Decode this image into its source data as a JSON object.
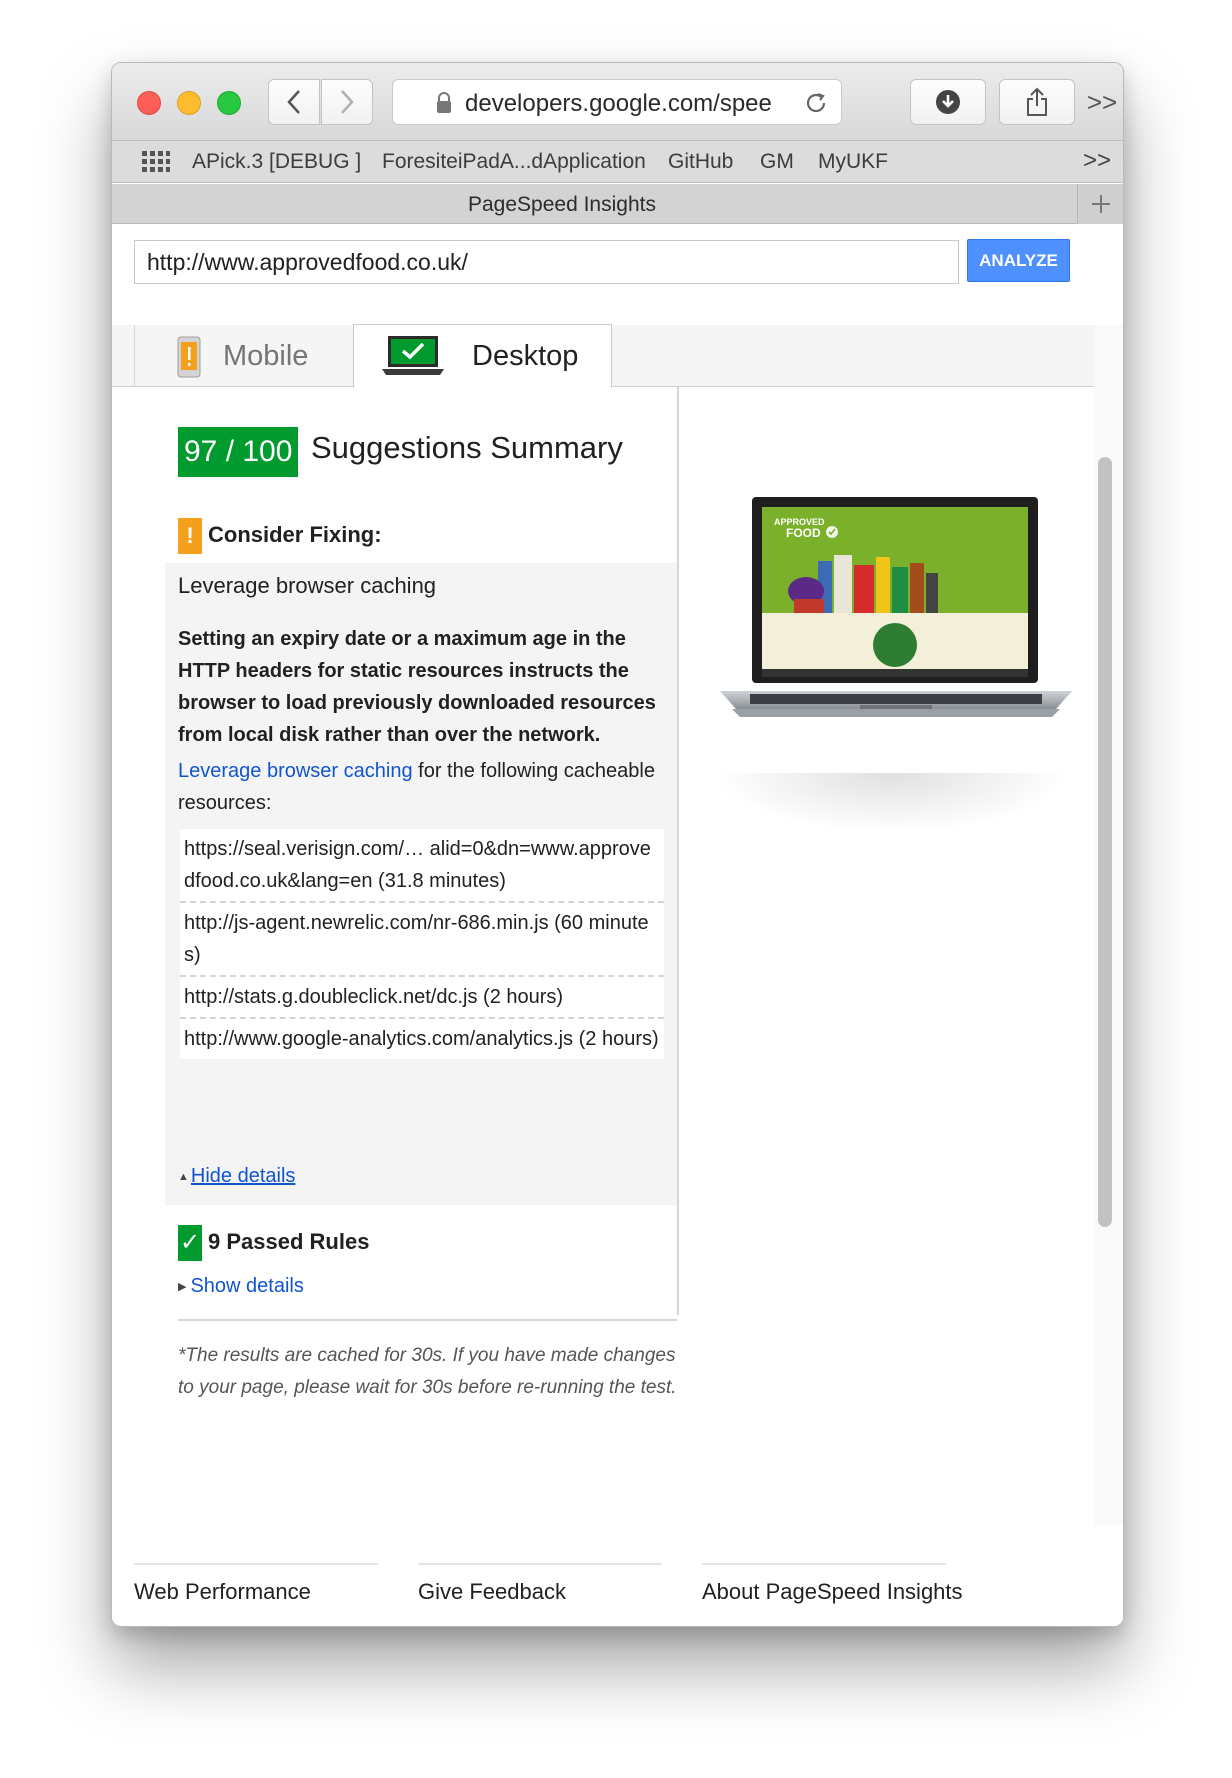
{
  "browser": {
    "address": "developers.google.com/spee",
    "tab_title": "PageSpeed Insights",
    "bookmarks": [
      "APick.3 [DEBUG ]",
      "ForesiteiPadA...dApplication",
      "GitHub",
      "GM",
      "MyUKF"
    ],
    "more_glyph": ">>",
    "new_tab_glyph": "+"
  },
  "page": {
    "url_value": "http://www.approvedfood.co.uk/",
    "analyze_label": "ANALYZE",
    "tabs": [
      {
        "label": "Mobile",
        "icon": "phone-warning-icon",
        "active": false
      },
      {
        "label": "Desktop",
        "icon": "laptop-check-icon",
        "active": true
      }
    ],
    "score": "97 / 100",
    "summary_title": "Suggestions Summary",
    "consider_label": "Consider Fixing:",
    "rule_title": "Leverage browser caching",
    "rule_description": "Setting an expiry date or a maximum age in the HTTP headers for static resources instructs the browser to load previously downloaded resources from local disk rather than over the network.",
    "rule_link_text": "Leverage browser caching",
    "rule_link_suffix": " for the following cacheable resources:",
    "resources": [
      "https://seal.verisign.com/… alid=0&dn=www.approvedfood.co.uk&lang=en (31.8 minutes)",
      "http://js-agent.newrelic.com/nr-686.min.js (60 minutes)",
      "http://stats.g.doubleclick.net/dc.js (2 hours)",
      "http://www.google-analytics.com/analytics.js (2 hours)"
    ],
    "hide_details": "Hide details",
    "passed_label": "9 Passed Rules",
    "show_details": "Show details",
    "cache_note": "*The results are cached for 30s. If you have made changes to your page, please wait for 30s before re-running the test.",
    "preview": {
      "brand_line1": "APPROVED",
      "brand_line2": "FOOD"
    },
    "footer": [
      "Web Performance",
      "Give Feedback",
      "About PageSpeed Insights"
    ]
  },
  "colors": {
    "score_green": "#009a2e",
    "warning_orange": "#f4a01c",
    "link_blue": "#1155cc",
    "analyze_blue": "#4d90fe"
  }
}
